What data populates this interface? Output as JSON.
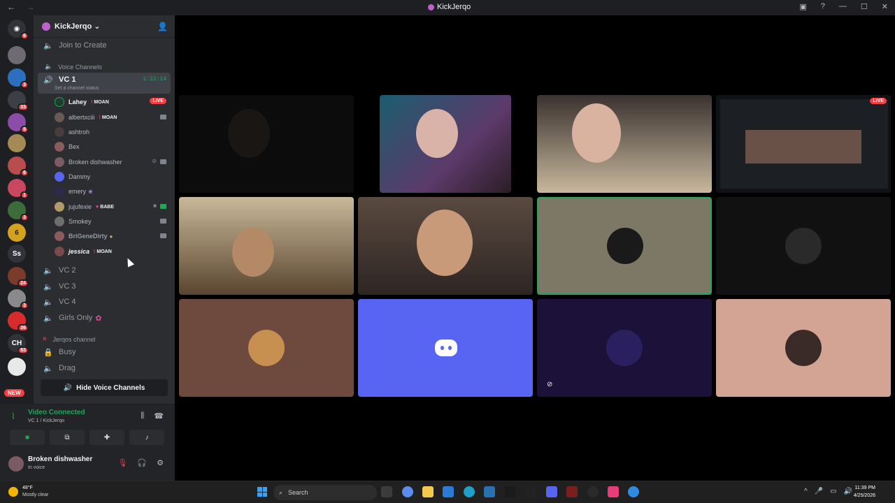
{
  "window": {
    "title": "KickJerqo",
    "back": "←",
    "forward": "→"
  },
  "server_rail": {
    "badges": [
      "6",
      "3",
      "33",
      "5",
      "6",
      "1",
      "3",
      "24",
      "3",
      "36",
      "53"
    ],
    "labels": {
      "ss": "Ss",
      "ch": "CH",
      "new": "NEW"
    }
  },
  "guild": {
    "name": "KickJerqo ⌄"
  },
  "channels": {
    "join_to_create": "Join to Create",
    "voice_category": "Voice Channels",
    "vc1": {
      "name": "VC 1",
      "timer": "1:22:14",
      "status": "Set a channel status"
    },
    "members": [
      {
        "name": "Lahey",
        "tag": "MOAN",
        "live": "LIVE"
      },
      {
        "name": "albertxciii",
        "tag": "MOAN"
      },
      {
        "name": "ashtroh"
      },
      {
        "name": "Bex"
      },
      {
        "name": "Broken dishwasher"
      },
      {
        "name": "Dammy"
      },
      {
        "name": "emery"
      },
      {
        "name": "jujufexie",
        "tag": "BABE"
      },
      {
        "name": "Smokey"
      },
      {
        "name": "BriGeneDirty"
      },
      {
        "name": "jessica",
        "tag": "MOAN"
      }
    ],
    "vc2": "VC 2",
    "vc3": "VC 3",
    "vc4": "VC 4",
    "girls_only": "Girls Only",
    "jerqos_category": "Jerqos channel",
    "busy": "Busy",
    "drag": "Drag",
    "hide_voice": "Hide Voice Channels"
  },
  "voice_panel": {
    "status": "Video Connected",
    "location": "VC 1 / KickJerqo"
  },
  "user_panel": {
    "name": "Broken dishwasher",
    "status": "In voice"
  },
  "stage": {
    "live_badge": "LIVE"
  },
  "taskbar": {
    "temp": "48°F",
    "condition": "Mostly clear",
    "search": "Search",
    "time": "11:39 PM",
    "date": "4/25/2026"
  }
}
